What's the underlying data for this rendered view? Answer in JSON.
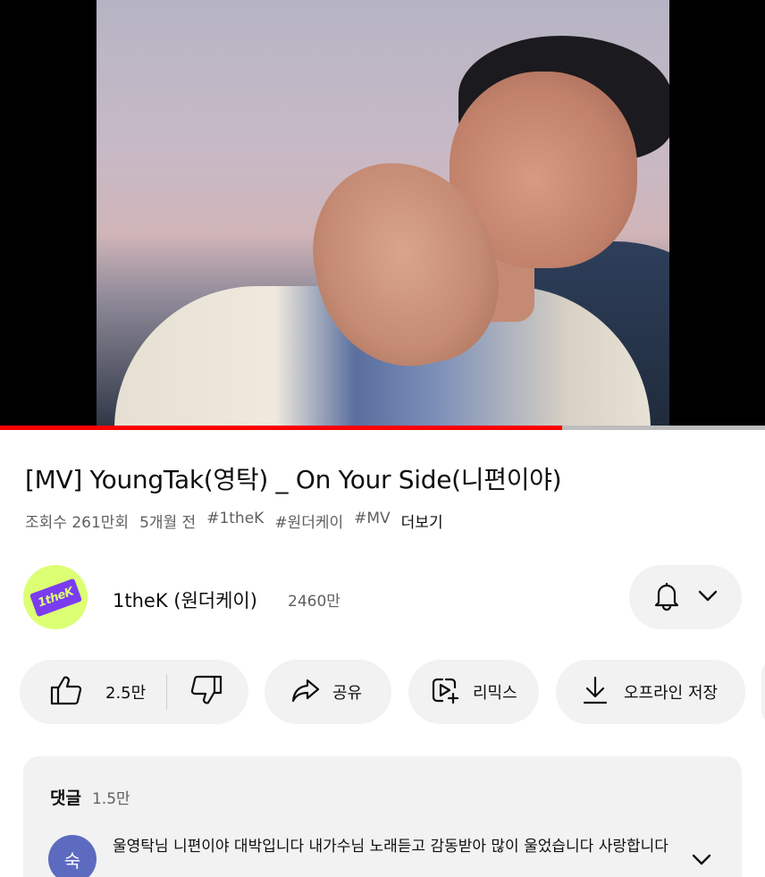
{
  "video": {
    "progress_fraction": 0.735
  },
  "title": "[MV] YoungTak(영탁) _ On Your Side(니편이야)",
  "meta": {
    "views": "조회수 261만회",
    "age": "5개월 전",
    "tags": [
      "#1theK",
      "#원더케이",
      "#MV"
    ],
    "more": "더보기"
  },
  "channel": {
    "logo_text": "1theK",
    "name": "1theK (원더케이)",
    "subscribers": "2460만"
  },
  "actions": {
    "likes": "2.5만",
    "share": "공유",
    "remix": "리믹스",
    "offline": "오프라인 저장"
  },
  "comments": {
    "title": "댓글",
    "count": "1.5만",
    "first": {
      "avatar_letter": "숙",
      "text": "울영탁님 니편이야 대박입니다 내가수님 노래듣고 감동받아 많이 울었습니다 사랑합니다"
    }
  },
  "colors": {
    "accent": "#ff0000",
    "chip_bg": "#f2f2f2",
    "channel_avatar_bg": "#dcff73",
    "channel_logo_bg": "#7a3cf0",
    "comment_avatar_bg": "#5c6bc0"
  },
  "icons": [
    "bell-icon",
    "chevron-down-icon",
    "thumbs-up-icon",
    "thumbs-down-icon",
    "share-icon",
    "remix-icon",
    "download-icon"
  ]
}
